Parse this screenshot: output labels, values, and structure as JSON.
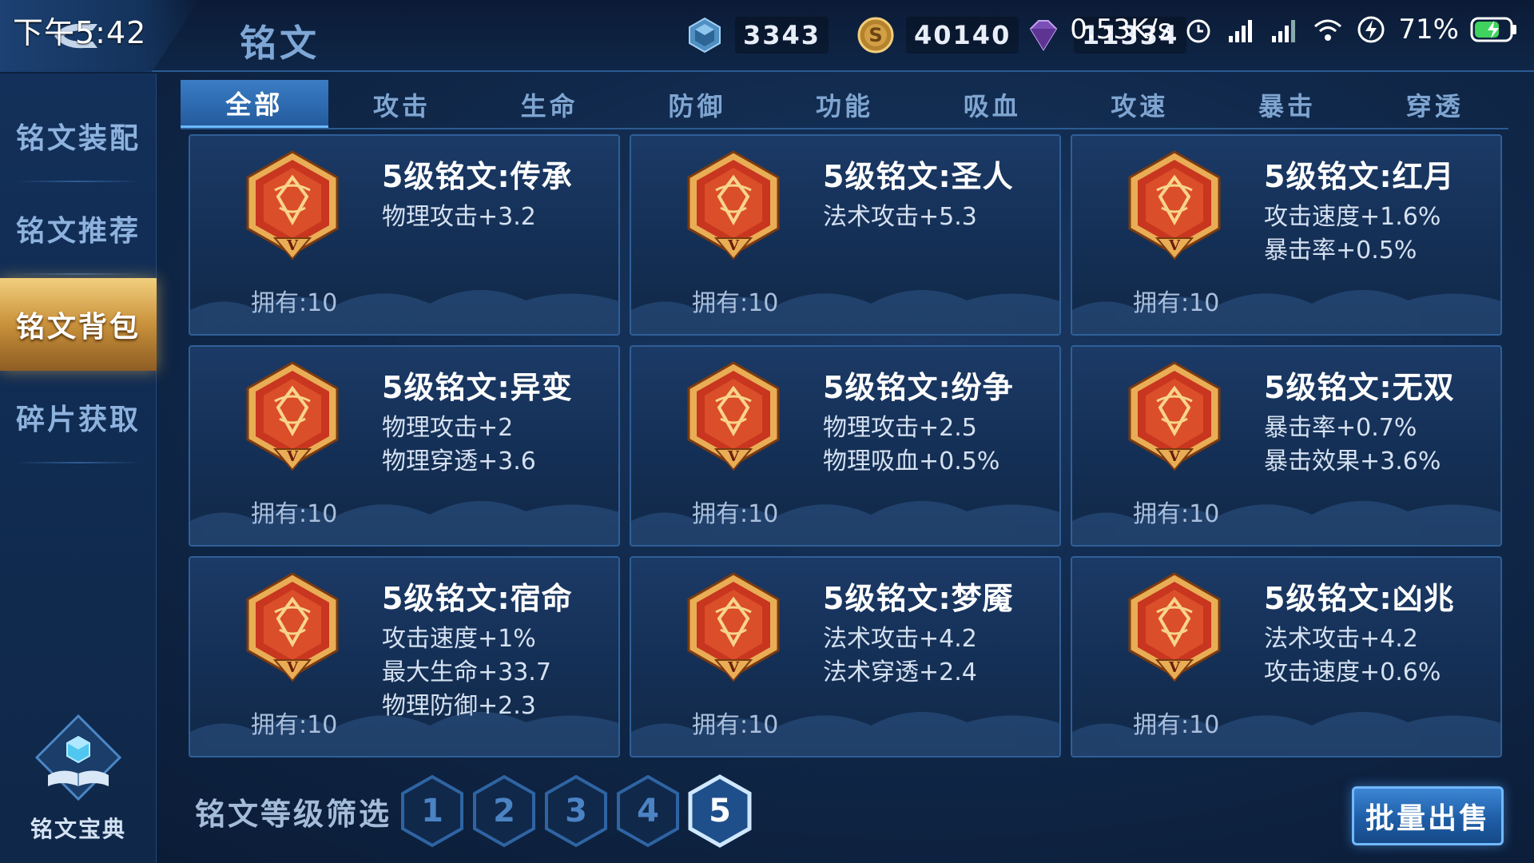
{
  "status_bar": {
    "time": "下午5:42",
    "net_speed": "0.53K/s",
    "battery": "71%"
  },
  "header": {
    "title": "铭文",
    "currencies": [
      {
        "icon": "blue-crystal-icon",
        "value": "3343"
      },
      {
        "icon": "gold-coin-icon",
        "value": "40140"
      },
      {
        "icon": "purple-gem-icon",
        "value": "11334"
      }
    ]
  },
  "sidebar": {
    "items": [
      {
        "label": "铭文装配"
      },
      {
        "label": "铭文推荐"
      },
      {
        "label": "铭文背包"
      },
      {
        "label": "碎片获取"
      }
    ],
    "active_index": 2,
    "codex_label": "铭文宝典"
  },
  "tabs": {
    "items": [
      {
        "label": "全部"
      },
      {
        "label": "攻击"
      },
      {
        "label": "生命"
      },
      {
        "label": "防御"
      },
      {
        "label": "功能"
      },
      {
        "label": "吸血"
      },
      {
        "label": "攻速"
      },
      {
        "label": "暴击"
      },
      {
        "label": "穿透"
      }
    ],
    "active_index": 0
  },
  "inscriptions": [
    {
      "name": "5级铭文:传承",
      "stats": [
        "物理攻击+3.2"
      ],
      "owned": "拥有:10",
      "icon": "inheritance-crest-icon"
    },
    {
      "name": "5级铭文:圣人",
      "stats": [
        "法术攻击+5.3"
      ],
      "owned": "拥有:10",
      "icon": "sage-crest-icon"
    },
    {
      "name": "5级铭文:红月",
      "stats": [
        "攻击速度+1.6%",
        "暴击率+0.5%"
      ],
      "owned": "拥有:10",
      "icon": "red-moon-crest-icon"
    },
    {
      "name": "5级铭文:异变",
      "stats": [
        "物理攻击+2",
        "物理穿透+3.6"
      ],
      "owned": "拥有:10",
      "icon": "mutation-crest-icon"
    },
    {
      "name": "5级铭文:纷争",
      "stats": [
        "物理攻击+2.5",
        "物理吸血+0.5%"
      ],
      "owned": "拥有:10",
      "icon": "strife-crest-icon"
    },
    {
      "name": "5级铭文:无双",
      "stats": [
        "暴击率+0.7%",
        "暴击效果+3.6%"
      ],
      "owned": "拥有:10",
      "icon": "peerless-crest-icon"
    },
    {
      "name": "5级铭文:宿命",
      "stats": [
        "攻击速度+1%",
        "最大生命+33.7",
        "物理防御+2.3"
      ],
      "owned": "拥有:10",
      "icon": "fate-crest-icon"
    },
    {
      "name": "5级铭文:梦魇",
      "stats": [
        "法术攻击+4.2",
        "法术穿透+2.4"
      ],
      "owned": "拥有:10",
      "icon": "nightmare-crest-icon"
    },
    {
      "name": "5级铭文:凶兆",
      "stats": [
        "法术攻击+4.2",
        "攻击速度+0.6%"
      ],
      "owned": "拥有:10",
      "icon": "omen-crest-icon"
    }
  ],
  "level_filter": {
    "label": "铭文等级筛选",
    "levels": [
      "1",
      "2",
      "3",
      "4",
      "5"
    ],
    "active_index": 4
  },
  "batch_sell_label": "批量出售",
  "colors": {
    "accent_blue": "#3a7dc5",
    "active_gold": "#c9913b",
    "emblem_red": "#c8361f",
    "emblem_gold": "#f0b653"
  }
}
